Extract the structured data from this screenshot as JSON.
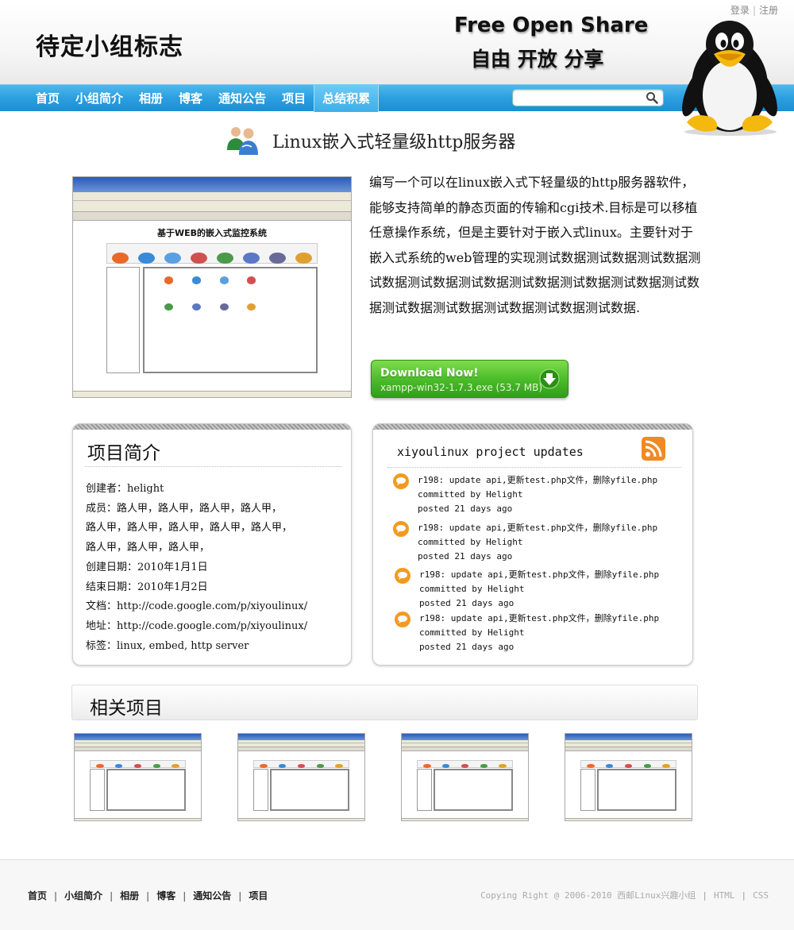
{
  "toplinks": {
    "login": "登录",
    "sep": "|",
    "register": "注册"
  },
  "header": {
    "logo_text": "待定小组标志",
    "slogan_en": "Free Open Share",
    "slogan_cn": "自由 开放 分享"
  },
  "nav": {
    "items": [
      "首页",
      "小组简介",
      "相册",
      "博客",
      "通知公告",
      "项目",
      "总结积累"
    ],
    "active_index": 6
  },
  "search": {
    "placeholder": "",
    "value": ""
  },
  "project": {
    "title": "Linux嵌入式轻量级http服务器",
    "description": "编写一个可以在linux嵌入式下轻量级的http服务器软件，能够支持简单的静态页面的传输和cgi技术.目标是可以移植任意操作系统，但是主要针对于嵌入式linux。主要针对于嵌入式系统的web管理的实现测试数据测试数据测试数据测试数据测试数据测试数据测试数据测试数据测试数据测试数据测试数据测试数据测试数据测试数据测试数据.",
    "screenshot_title": "基于WEB的嵌入式监控系统"
  },
  "download": {
    "label": "Download Now!",
    "file": "xampp-win32-1.7.3.exe (53.7 MB)"
  },
  "intro": {
    "heading": "项目简介",
    "lines": [
      "创建者：helight",
      "成员：路人甲，路人甲，路人甲，路人甲，",
      "路人甲，路人甲，路人甲，路人甲，路人甲，",
      "路人甲，路人甲，路人甲，",
      "创建日期：2010年1月1日",
      "结束日期：2010年1月2日",
      "文档：http://code.google.com/p/xiyoulinux/",
      "地址：http://code.google.com/p/xiyoulinux/",
      "标签：linux, embed, http server"
    ]
  },
  "updates": {
    "heading": "xiyoulinux project updates",
    "items": [
      {
        "msg": "r198: update api,更新test.php文件，删除yfile.php",
        "by": "committed by Helight",
        "when": "posted 21 days ago"
      },
      {
        "msg": "r198: update api,更新test.php文件，删除yfile.php",
        "by": "committed by Helight",
        "when": "posted 21 days ago"
      },
      {
        "msg": "r198: update api,更新test.php文件，删除yfile.php",
        "by": "committed by Helight",
        "when": "posted 21 days ago"
      },
      {
        "msg": "r198: update api,更新test.php文件，删除yfile.php",
        "by": "committed by Helight",
        "when": "posted 21 days ago"
      }
    ]
  },
  "related": {
    "heading": "相关项目",
    "count": 4
  },
  "footer": {
    "links": [
      "首页",
      "小组简介",
      "相册",
      "博客",
      "通知公告",
      "项目"
    ],
    "copyright": "Copying Right @ 2006-2010 西邮Linux兴趣小组",
    "html": "HTML",
    "css": "CSS"
  }
}
